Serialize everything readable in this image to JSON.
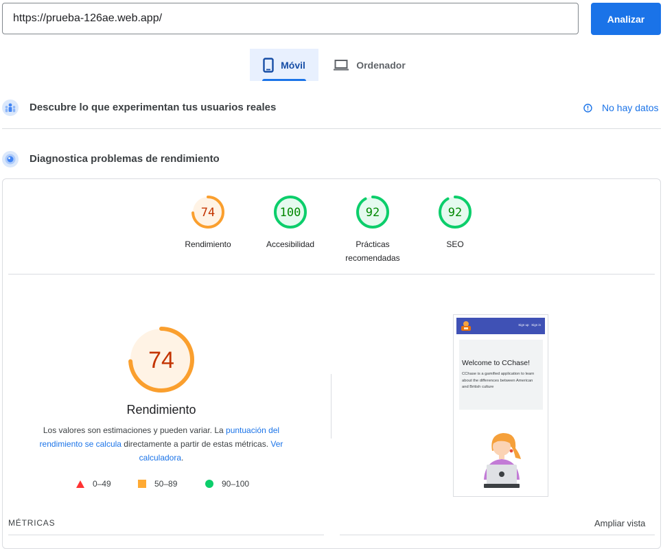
{
  "url_bar": {
    "value": "https://prueba-126ae.web.app/",
    "analyze_label": "Analizar"
  },
  "device_tabs": {
    "mobile_label": "Móvil",
    "desktop_label": "Ordenador"
  },
  "field_data": {
    "title": "Descubre lo que experimentan tus usuarios reales",
    "status": "No hay datos"
  },
  "lab_data": {
    "title": "Diagnostica problemas de rendimiento"
  },
  "scores": [
    {
      "label": "Rendimiento",
      "value": 74,
      "color": "#fa9f2e",
      "text_color": "#c33300",
      "bg": "#fff3e5"
    },
    {
      "label": "Accesibilidad",
      "value": 100,
      "color": "#0cce6b",
      "text_color": "#008800",
      "bg": "#e5faef"
    },
    {
      "label": "Prácticas recomendadas",
      "value": 92,
      "color": "#0cce6b",
      "text_color": "#008800",
      "bg": "#e5faef"
    },
    {
      "label": "SEO",
      "value": 92,
      "color": "#0cce6b",
      "text_color": "#008800",
      "bg": "#e5faef"
    }
  ],
  "performance": {
    "score": "74",
    "title": "Rendimiento",
    "desc_part1": "Los valores son estimaciones y pueden variar. La ",
    "desc_link1": "puntuación del rendimiento se calcula",
    "desc_part2": " directamente a partir de estas métricas. ",
    "desc_link2": "Ver calculadora",
    "desc_part3": "."
  },
  "legend": [
    {
      "range": "0–49",
      "color": "#ff3333",
      "shape": "triangle"
    },
    {
      "range": "50–89",
      "color": "#ffaa33",
      "shape": "square"
    },
    {
      "range": "90–100",
      "color": "#0cce6b",
      "shape": "circle"
    }
  ],
  "screenshot": {
    "nav_links": "Sign up   Sign in",
    "heading": "Welcome to CChase!",
    "body": "CChase is a gamified application to learn about the differences between American and British culture"
  },
  "metrics": {
    "label": "MÉTRICAS",
    "expand": "Ampliar vista"
  }
}
